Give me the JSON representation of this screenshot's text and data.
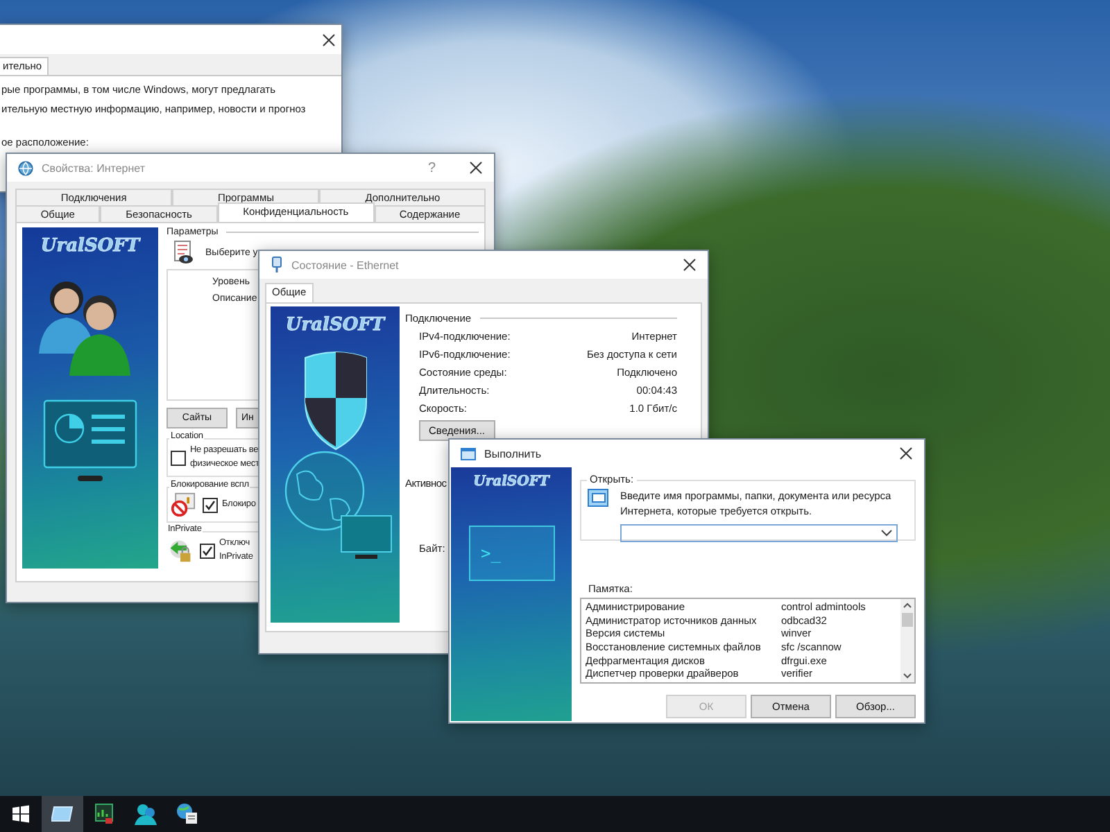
{
  "background_window": {
    "tab": {
      "label": "ительно",
      "selected": true
    },
    "lines": [
      "рые программы, в том числе Windows, могут предлагать",
      "ительную местную информацию, например, новости и прогноз",
      "ое расположение:"
    ]
  },
  "internet_properties": {
    "title": "Свойства: Интернет",
    "help": "?",
    "tab_rows": [
      [
        {
          "label": "Подключения",
          "selected": false
        },
        {
          "label": "Программы",
          "selected": false
        },
        {
          "label": "Дополнительно",
          "selected": false
        }
      ],
      [
        {
          "label": "Общие",
          "selected": false
        },
        {
          "label": "Безопасность",
          "selected": false
        },
        {
          "label": "Конфиденциальность",
          "selected": true
        },
        {
          "label": "Содержание",
          "selected": false
        }
      ]
    ],
    "logo": "UralSOFT",
    "parameters": {
      "heading": "Параметры",
      "prompt": "Выберите у",
      "fields": [
        "Уровень",
        "Описание"
      ]
    },
    "buttons": [
      "Сайты",
      "Ин"
    ],
    "location": {
      "heading": "Location",
      "checkbox": {
        "lines": [
          "Не разрешать ве",
          "физическое мест"
        ],
        "checked": false
      }
    },
    "popup_blocking": {
      "heading": "Блокирование вспл",
      "checkbox": {
        "lines": [
          "Блокиро"
        ],
        "checked": true
      }
    },
    "inprivate": {
      "heading": "InPrivate",
      "checkbox": {
        "lines": [
          "Отключ",
          "InPrivate"
        ],
        "checked": true
      }
    }
  },
  "ethernet_status": {
    "title": "Состояние - Ethernet",
    "tabs": [
      {
        "label": "Общие",
        "selected": true
      }
    ],
    "logo": "UralSOFT",
    "connection": {
      "heading": "Подключение",
      "rows": [
        {
          "label": "IPv4-подключение:",
          "value": "Интернет"
        },
        {
          "label": "IPv6-подключение:",
          "value": "Без доступа к сети"
        },
        {
          "label": "Состояние среды:",
          "value": "Подключено"
        },
        {
          "label": "Длительность:",
          "value": "00:04:43"
        },
        {
          "label": "Скорость:",
          "value": "1.0 Гбит/с"
        }
      ]
    },
    "details_button": "Сведения...",
    "activity_heading": "Активнос",
    "bytes_label": "Байт:"
  },
  "run_dialog": {
    "title": "Выполнить",
    "logo": "UralSOFT",
    "terminal_prompt": ">_",
    "open_group": {
      "heading": "Открыть:",
      "prompt_lines": [
        "Введите имя программы, папки, документа или ресурса",
        "Интернета, которые требуется открыть."
      ]
    },
    "memo": {
      "heading": "Памятка:",
      "rows": [
        {
          "name": "Администрирование",
          "command": "control admintools"
        },
        {
          "name": "Администратор источников данных",
          "command": "odbcad32"
        },
        {
          "name": "Версия системы",
          "command": "winver"
        },
        {
          "name": "Восстановление системных файлов",
          "command": "sfc /scannow"
        },
        {
          "name": "Дефрагментация дисков",
          "command": "dfrgui.exe"
        },
        {
          "name": "Диспетчер проверки драйверов",
          "command": "verifier"
        }
      ]
    },
    "buttons": [
      {
        "label": "ОК",
        "disabled": true
      },
      {
        "label": "Отмена",
        "disabled": false
      },
      {
        "label": "Обзор...",
        "disabled": false
      }
    ]
  },
  "taskbar": {
    "items": [
      {
        "kind": "start",
        "selected": false
      },
      {
        "kind": "run",
        "selected": true
      },
      {
        "kind": "monitor",
        "selected": false
      },
      {
        "kind": "users",
        "selected": false
      },
      {
        "kind": "globe",
        "selected": false
      }
    ]
  }
}
